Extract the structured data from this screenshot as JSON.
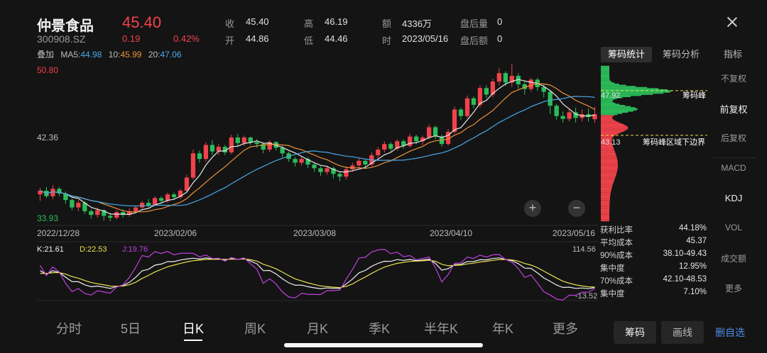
{
  "header": {
    "name": "仲景食品",
    "price": "45.40",
    "code": "300908.SZ",
    "change": "0.19",
    "change_pct": "0.42%",
    "quote": [
      {
        "label": "收",
        "value": "45.40"
      },
      {
        "label": "高",
        "value": "46.19"
      },
      {
        "label": "额",
        "value": "4336万"
      },
      {
        "label": "盘后量",
        "value": "0"
      },
      {
        "label": "开",
        "value": "44.86"
      },
      {
        "label": "低",
        "value": "44.46"
      },
      {
        "label": "时",
        "value": "2023/05/16"
      },
      {
        "label": "盘后额",
        "value": "0"
      }
    ],
    "ma": {
      "overlay": "叠加",
      "ma5_label": "MA5:",
      "ma5": "44.98",
      "ma10_label": "10:",
      "ma10": "45.99",
      "ma20_label": "20:",
      "ma20": "47.06"
    }
  },
  "colors": {
    "up": "#f0424a",
    "down": "#2bbd5a",
    "ma5": "#e8e8e8",
    "ma10": "#e8923a",
    "ma20": "#4aa8e8",
    "k": "#f0f0f0",
    "d": "#e8e050",
    "j": "#c040e0"
  },
  "right_tabs": {
    "chip_stat": "筹码统计",
    "chip_analysis": "筹码分析",
    "indicator": "指标"
  },
  "side_menu": [
    "不复权",
    "前复权",
    "后复权",
    "MACD",
    "KDJ",
    "VOL",
    "成交额",
    "更多"
  ],
  "chip_panel": {
    "peak_value": "47.92",
    "peak_label": "筹码峰",
    "low_value": "43.13",
    "low_label": "筹码峰区域下边界"
  },
  "chip_stats": [
    {
      "label": "获利比率",
      "value": "44.18%"
    },
    {
      "label": "平均成本",
      "value": "45.37"
    },
    {
      "label": "90%成本",
      "value": "38.10-49.43"
    },
    {
      "label": "集中度",
      "value": "12.95%"
    },
    {
      "label": "70%成本",
      "value": "42.10-48.53"
    },
    {
      "label": "集中度",
      "value": "7.10%"
    }
  ],
  "kdj": {
    "k_label": "K:21.61",
    "d_label": "D:22.53",
    "j_label": "J:19.76",
    "max": "114.56",
    "min": "-13.52"
  },
  "bottom_tabs": [
    "分时",
    "5日",
    "日K",
    "周K",
    "月K",
    "季K",
    "半年K",
    "年K",
    "更多"
  ],
  "bottom_buttons": {
    "chip": "筹码",
    "draw": "画线",
    "watch": "删自选"
  },
  "chart_data": {
    "type": "candlestick",
    "price_axis": {
      "max": "50.80",
      "mid": "42.36",
      "min": "33.93",
      "ylim": [
        33.93,
        50.8
      ]
    },
    "dates": [
      "2022/12/28",
      "2023/02/06",
      "2023/03/08",
      "2023/04/10",
      "2023/05/16"
    ],
    "candles": [
      [
        36.8,
        37.2,
        36.1,
        37.5
      ],
      [
        37.2,
        36.6,
        36.4,
        37.6
      ],
      [
        36.6,
        37.4,
        36.3,
        37.8
      ],
      [
        37.4,
        36.9,
        36.6,
        37.6
      ],
      [
        36.9,
        36.2,
        35.8,
        37.1
      ],
      [
        36.2,
        35.4,
        35.1,
        36.4
      ],
      [
        35.4,
        35.9,
        35.0,
        36.2
      ],
      [
        35.9,
        35.0,
        34.7,
        36.1
      ],
      [
        35.0,
        34.6,
        34.2,
        35.2
      ],
      [
        34.6,
        35.1,
        34.3,
        35.4
      ],
      [
        35.1,
        34.5,
        34.0,
        35.2
      ],
      [
        34.5,
        34.3,
        33.93,
        34.8
      ],
      [
        34.3,
        34.9,
        34.1,
        35.1
      ],
      [
        34.9,
        34.6,
        34.3,
        35.2
      ],
      [
        34.6,
        35.0,
        34.4,
        35.3
      ],
      [
        35.0,
        35.4,
        34.8,
        35.6
      ],
      [
        35.4,
        35.9,
        35.2,
        36.1
      ],
      [
        35.9,
        35.6,
        35.4,
        36.3
      ],
      [
        35.6,
        36.4,
        35.5,
        36.6
      ],
      [
        36.4,
        36.1,
        35.8,
        36.6
      ],
      [
        36.1,
        36.8,
        35.9,
        37.0
      ],
      [
        36.8,
        36.5,
        36.2,
        37.0
      ],
      [
        36.5,
        37.2,
        36.3,
        37.4
      ],
      [
        37.2,
        38.6,
        37.0,
        38.9
      ],
      [
        38.6,
        41.2,
        38.4,
        41.6
      ],
      [
        41.2,
        40.6,
        40.2,
        41.5
      ],
      [
        40.6,
        42.1,
        40.3,
        42.4
      ],
      [
        42.1,
        41.4,
        41.0,
        42.6
      ],
      [
        41.4,
        41.9,
        41.0,
        42.2
      ],
      [
        41.9,
        41.3,
        41.0,
        42.1
      ],
      [
        41.3,
        42.9,
        41.1,
        43.2
      ],
      [
        42.9,
        42.3,
        41.9,
        43.3
      ],
      [
        42.3,
        42.9,
        42.0,
        43.1
      ],
      [
        42.9,
        42.4,
        42.1,
        43.0
      ],
      [
        42.4,
        42.2,
        41.8,
        42.7
      ],
      [
        42.2,
        41.6,
        41.2,
        42.4
      ],
      [
        41.6,
        42.4,
        41.3,
        42.6
      ],
      [
        42.4,
        41.8,
        41.5,
        42.5
      ],
      [
        41.8,
        41.2,
        40.8,
        42.0
      ],
      [
        41.2,
        40.6,
        40.3,
        41.4
      ],
      [
        40.6,
        40.2,
        39.8,
        40.8
      ],
      [
        40.2,
        40.6,
        39.9,
        40.9
      ],
      [
        40.6,
        40.0,
        39.6,
        40.8
      ],
      [
        40.0,
        39.6,
        39.2,
        40.2
      ],
      [
        39.6,
        39.2,
        38.8,
        39.8
      ],
      [
        39.2,
        39.6,
        38.9,
        39.9
      ],
      [
        39.6,
        39.0,
        38.5,
        39.8
      ],
      [
        39.0,
        38.7,
        38.2,
        39.2
      ],
      [
        38.7,
        39.5,
        38.4,
        39.8
      ],
      [
        39.5,
        39.9,
        39.2,
        40.2
      ],
      [
        39.9,
        40.4,
        39.6,
        40.7
      ],
      [
        40.4,
        40.0,
        39.7,
        40.6
      ],
      [
        40.0,
        41.0,
        39.8,
        41.3
      ],
      [
        41.0,
        41.6,
        40.7,
        41.9
      ],
      [
        41.6,
        42.2,
        41.3,
        42.5
      ],
      [
        42.2,
        41.7,
        41.4,
        42.4
      ],
      [
        41.7,
        42.5,
        41.5,
        42.7
      ],
      [
        42.5,
        42.0,
        41.7,
        42.7
      ],
      [
        42.0,
        43.0,
        41.8,
        43.3
      ],
      [
        43.0,
        42.5,
        42.2,
        43.2
      ],
      [
        42.5,
        42.9,
        42.1,
        43.1
      ],
      [
        42.9,
        44.0,
        42.7,
        44.3
      ],
      [
        44.0,
        43.0,
        42.7,
        44.2
      ],
      [
        43.0,
        42.2,
        41.9,
        43.2
      ],
      [
        42.2,
        43.5,
        42.0,
        43.8
      ],
      [
        43.5,
        45.9,
        43.3,
        46.2
      ],
      [
        45.9,
        45.2,
        44.8,
        46.1
      ],
      [
        45.2,
        47.1,
        45.0,
        47.4
      ],
      [
        47.1,
        46.4,
        46.0,
        47.3
      ],
      [
        46.4,
        48.2,
        46.1,
        48.5
      ],
      [
        48.2,
        47.5,
        47.1,
        48.5
      ],
      [
        47.5,
        48.9,
        47.2,
        49.2
      ],
      [
        48.9,
        49.8,
        48.5,
        50.3
      ],
      [
        49.8,
        48.8,
        48.4,
        50.0
      ],
      [
        48.8,
        49.5,
        48.3,
        50.8
      ],
      [
        49.5,
        48.6,
        48.1,
        49.8
      ],
      [
        48.6,
        48.1,
        47.5,
        48.9
      ],
      [
        48.1,
        49.1,
        47.8,
        49.3
      ],
      [
        49.1,
        48.3,
        47.9,
        49.3
      ],
      [
        48.3,
        47.8,
        47.2,
        48.6
      ],
      [
        47.8,
        46.3,
        45.4,
        48.0
      ],
      [
        46.3,
        45.2,
        44.8,
        46.5
      ],
      [
        45.2,
        44.9,
        44.5,
        45.7
      ],
      [
        44.9,
        45.6,
        44.6,
        46.0
      ],
      [
        45.6,
        45.0,
        44.5,
        46.1
      ],
      [
        45.0,
        45.4,
        44.6,
        45.9
      ],
      [
        45.4,
        45.1,
        44.6,
        46.0
      ],
      [
        44.86,
        45.4,
        44.46,
        46.19
      ]
    ],
    "kdj_ylim": [
      -13.52,
      114.56
    ]
  }
}
